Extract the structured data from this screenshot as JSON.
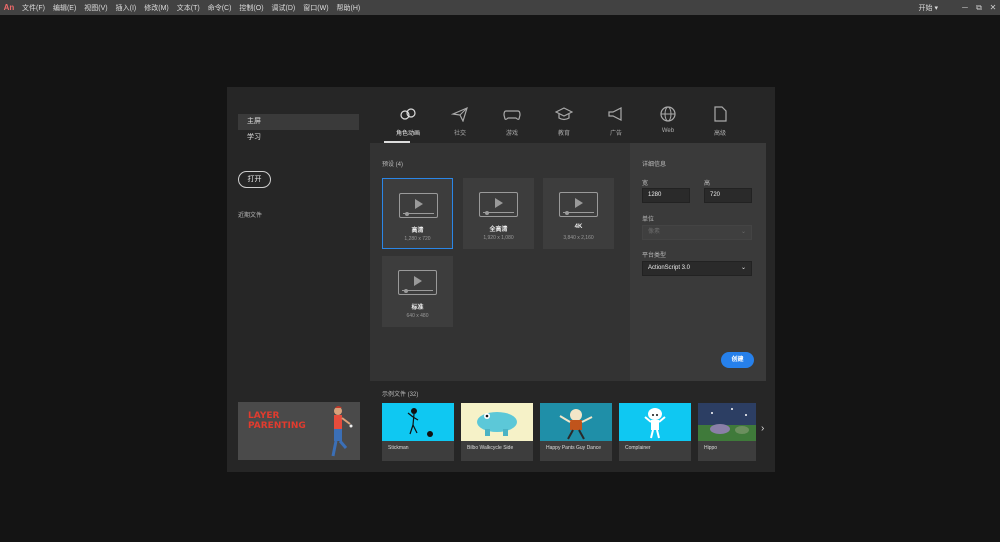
{
  "menubar": {
    "logo": "An",
    "items": [
      "文件(F)",
      "编辑(E)",
      "视图(V)",
      "插入(I)",
      "修改(M)",
      "文本(T)",
      "命令(C)",
      "控制(O)",
      "调试(D)",
      "窗口(W)",
      "帮助(H)"
    ],
    "workspace": "开始",
    "workspace_chevron": "▾",
    "window_buttons": [
      "─",
      "⧉",
      "✕"
    ]
  },
  "sidebar": {
    "items": [
      {
        "label": "主屏"
      },
      {
        "label": "学习"
      }
    ],
    "open_label": "打开",
    "recent_label": "近期文件"
  },
  "promo": {
    "line1": "LAYER",
    "line2": "PARENTING"
  },
  "categories": [
    {
      "label": "角色动画",
      "icon": "character-animation-icon"
    },
    {
      "label": "社交",
      "icon": "paper-plane-icon"
    },
    {
      "label": "游戏",
      "icon": "gamepad-icon"
    },
    {
      "label": "教育",
      "icon": "graduation-cap-icon"
    },
    {
      "label": "广告",
      "icon": "megaphone-icon"
    },
    {
      "label": "Web",
      "icon": "globe-icon"
    },
    {
      "label": "高级",
      "icon": "document-icon"
    }
  ],
  "presets": {
    "title": "预设 (4)",
    "items": [
      {
        "name": "高清",
        "res": "1,280 x 720"
      },
      {
        "name": "全高清",
        "res": "1,920 x 1,080"
      },
      {
        "name": "4K",
        "res": "3,840 x 2,160"
      },
      {
        "name": "标准",
        "res": "640 x 480"
      }
    ]
  },
  "details": {
    "title": "详细信息",
    "width_label": "宽",
    "width_value": "1280",
    "height_label": "高",
    "height_value": "720",
    "units_label": "单位",
    "units_value": "像素",
    "platform_label": "平台类型",
    "platform_value": "ActionScript 3.0",
    "create_label": "创建"
  },
  "samples": {
    "title": "示例文件 (32)",
    "items": [
      {
        "label": "Stickman"
      },
      {
        "label": "Bilbo Walkcycle Side"
      },
      {
        "label": "Happy Pants Guy Dance"
      },
      {
        "label": "Complainer"
      },
      {
        "label": "Hippo"
      }
    ],
    "next_arrow": "›"
  },
  "colors": {
    "accent": "#2680eb",
    "promo_text": "#e23b2e",
    "sample_cyan": "#0fc8f2"
  }
}
